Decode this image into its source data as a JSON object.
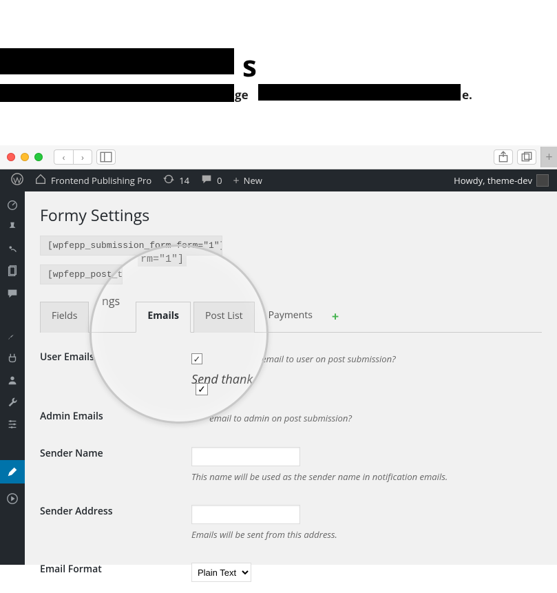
{
  "header_hero": {
    "title_suffix": "s",
    "sub_mid": "ge",
    "sub_end": "e."
  },
  "browser": {
    "nav_back": "‹",
    "nav_fwd": "›",
    "share": "⇪",
    "tabs_icon": "⧉",
    "plus": "+"
  },
  "adminbar": {
    "site_name": "Frontend Publishing Pro",
    "updates_count": "14",
    "comments_count": "0",
    "new_label": "New",
    "howdy": "Howdy, theme-dev"
  },
  "page": {
    "title": "Formy Settings",
    "shortcode1": "[wpfepp_submission_form form=\"1\"]",
    "shortcode2": "[wpfepp_post_tab'",
    "mag_shortcode_frag": "rm=\"1\"]"
  },
  "tabs": {
    "items": [
      "Fields",
      "Settings",
      "Emails",
      "Post List",
      "Payments"
    ],
    "active_index": 2,
    "mag_frag": "ngs"
  },
  "form": {
    "user_emails": {
      "label": "User Emails",
      "checked": true,
      "desc_frag": "email to user on post submission?",
      "big_desc": "Send thank"
    },
    "admin_emails": {
      "label": "Admin Emails",
      "checked": true,
      "desc_frag": " email to admin on post submission?"
    },
    "sender_name": {
      "label": "Sender Name",
      "value": "",
      "desc": "This name will be used as the sender name in notification emails."
    },
    "sender_address": {
      "label": "Sender Address",
      "value": "",
      "desc": "Emails will be sent from this address."
    },
    "email_format": {
      "label": "Email Format",
      "value": "Plain Text"
    }
  }
}
